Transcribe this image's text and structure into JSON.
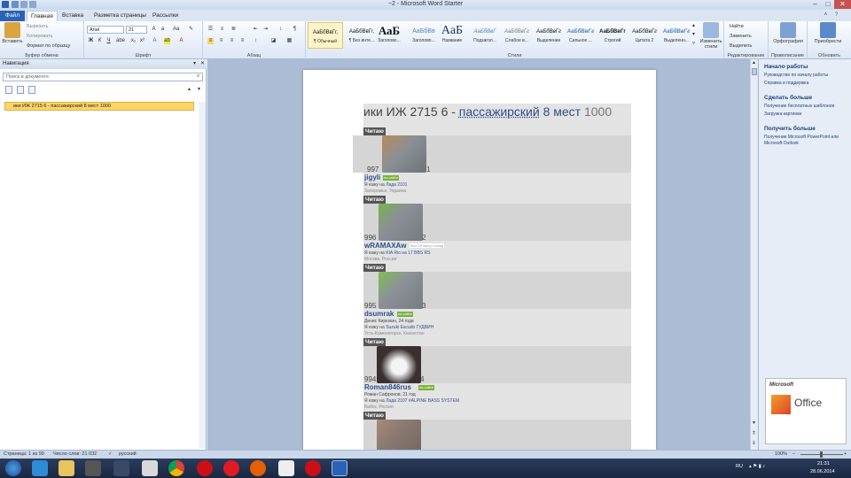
{
  "window": {
    "title": "~2 - Microsoft Word Starter"
  },
  "tabs": [
    {
      "label": "Файл"
    },
    {
      "label": "Главная"
    },
    {
      "label": "Вставка"
    },
    {
      "label": "Разметка страницы"
    },
    {
      "label": "Рассылки"
    }
  ],
  "ribbon": {
    "clipboard": {
      "paste": "Вставить",
      "cut": "Вырезать",
      "copy": "Копировать",
      "format": "Формат по образцу",
      "label": "Буфер обмена"
    },
    "font": {
      "name": "Arial",
      "size": "21",
      "label": "Шрифт"
    },
    "paragraph": {
      "label": "Абзац"
    },
    "styles": {
      "label": "Стили",
      "items": [
        {
          "preview": "АаБбВвГг,",
          "name": "¶ Обычный"
        },
        {
          "preview": "АаБбВвГг,",
          "name": "¶ Без инте..."
        },
        {
          "preview": "АаБ",
          "name": "Заголово..."
        },
        {
          "preview": "АаБбВв",
          "name": "Заголово..."
        },
        {
          "preview": "АаБ",
          "name": "Название"
        },
        {
          "preview": "АаБбВвГ",
          "name": "Подзагол..."
        },
        {
          "preview": "АаБбВвГг",
          "name": "Слабое в..."
        },
        {
          "preview": "АаБбВвГг",
          "name": "Выделение"
        },
        {
          "preview": "АаБбВвГг",
          "name": "Сильное ..."
        },
        {
          "preview": "АаБбВвГг",
          "name": "Строгий"
        },
        {
          "preview": "АаБбВвГг",
          "name": "Цитата 2"
        },
        {
          "preview": "АаБбВвГг",
          "name": "Выделенн..."
        }
      ],
      "change": "Изменить стили"
    },
    "editing": {
      "find": "Найти",
      "replace": "Заменить",
      "select": "Выделить",
      "label": "Редактирование"
    },
    "proofing": {
      "button": "Орфография",
      "label": "Правописание"
    },
    "update": {
      "button": "Приобрести",
      "label": "Обновить"
    }
  },
  "nav": {
    "title": "Навигация",
    "search_placeholder": "Поиск в документе",
    "item": "ики ИЖ 2715 6 - пассажирский 8 мест 1000"
  },
  "doc": {
    "title_a": "ики ИЖ 2715 6 - ",
    "title_b": "пассажирский",
    "title_c": " 8 мест ",
    "title_d": "1000",
    "reading": "Читаю",
    "entries": [
      {
        "rank": "997",
        "n": "1",
        "user": "jigyli",
        "onsite": "на сайте",
        "drive_pre": "Я езжу на ",
        "car": "Лада 2101",
        "location": "Запорожье, Украина"
      },
      {
        "rank": "996",
        "n": "2",
        "user": "wRAMAXAw",
        "lastseen": "был 29 минут назад",
        "drive_pre": "Я езжу на ",
        "car": "KIA Rio",
        "car_extra": " на 17 BBS RS",
        "location": "Москва, Россия"
      },
      {
        "rank": "995",
        "n": "3",
        "user": "dsumrak",
        "onsite": "на сайте",
        "person": "Денис Кирюхин, 24 года",
        "drive_pre": "Я езжу на ",
        "car": "Suzuki Escudo ГУДВИН",
        "location": "Усть-Каменогорск, Казахстан"
      },
      {
        "rank": "994",
        "n": "4",
        "user": "Roman846rus",
        "onsite": "на сайте",
        "person": "Роман Сафронов, 21 год",
        "drive_pre": "Я езжу на ",
        "car": "Лада 2107 #ALPINE BASS SYSTEM",
        "location": "Бийск, Россия"
      }
    ]
  },
  "taskpane": {
    "h1": "Начало работы",
    "l1": "Руководство по началу работы",
    "l2": "Справка и поддержка",
    "h2": "Сделать больше",
    "l3": "Получение бесплатных шаблонов",
    "l4": "Загрузка картинки",
    "h3": "Получить больше",
    "l5": "Получение Microsoft PowerPoint или",
    "l6": "Microsoft Outlook",
    "ad_brand": "Microsoft",
    "ad_product": "Office"
  },
  "status": {
    "page": "Страница: 1 из 99",
    "words": "Число слов: 21 032",
    "lang": "русский",
    "zoom": "100%"
  },
  "tray": {
    "lang": "RU",
    "time": "21:31",
    "date": "28.06.2014"
  }
}
